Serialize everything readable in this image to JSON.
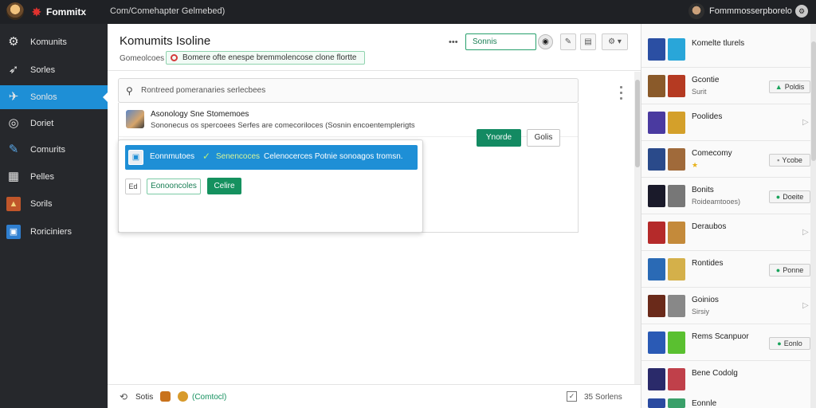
{
  "topbar": {
    "brand": "Fommitx",
    "crumb": "Com/Comehapter Gelmebed)",
    "user_name": "Fommmosserpborelo"
  },
  "sidebar": {
    "items": [
      {
        "label": "Komunits",
        "icon": "gear-icon"
      },
      {
        "label": "Sorles",
        "icon": "rocket-icon"
      },
      {
        "label": "Sonlos",
        "icon": "puzzle-icon"
      },
      {
        "label": "Doriet",
        "icon": "chat-icon"
      },
      {
        "label": "Comurits",
        "icon": "link-icon"
      },
      {
        "label": "Pelles",
        "icon": "grid-icon"
      },
      {
        "label": "Sorils",
        "icon": "image-icon"
      },
      {
        "label": "Roriciniers",
        "icon": "window-icon"
      }
    ],
    "active_index": 2,
    "accent": "#1e8fd6"
  },
  "main": {
    "title": "Komumits Isoline",
    "subtitle": "Gomeolcoes",
    "alert": "Bomere ofte enespe bremmolencose clone flortte",
    "more": "•••",
    "search_value": "Sonnis",
    "searchbar_placeholder": "Rontreed pomeranaries serlecbees",
    "row": {
      "name": "Asonology Sne Stomemoes",
      "desc": "Sononecus os spercoees Serfes are comecoriloces (Sosnin encoentemplerigts"
    },
    "primary_button": "Ynorde",
    "secondary_button": "Golis"
  },
  "popup": {
    "selected_a": "Eonnmutoes",
    "selected_b": "Senencoces",
    "selected_c": "Celenocerces Potnie sonoagos tromsn.",
    "small_label": "Ed",
    "ghost_button": "Eonooncoles",
    "ok_button": "Celire"
  },
  "bottombar": {
    "left_label": "Sotis",
    "status_label": "(Comtocl)",
    "right_label": "35 Sorlens"
  },
  "right_panel": {
    "items": [
      {
        "name": "Komelte tlurels",
        "sub": "",
        "action": "",
        "thumbs": [
          "#2b4fa3",
          "#29a6d9"
        ]
      },
      {
        "name": "Gcontie",
        "sub": "Surit",
        "action": "Poldis",
        "thumbs": [
          "#8a5a2a",
          "#b53a22"
        ]
      },
      {
        "name": "Poolides",
        "sub": "",
        "action": "",
        "thumbs": [
          "#4a3aa0",
          "#d4a02a"
        ]
      },
      {
        "name": "Comecomy",
        "sub": "★",
        "action": "Ycobe",
        "thumbs": [
          "#2a4a8a",
          "#a06a3a"
        ]
      },
      {
        "name": "Bonits",
        "sub": "Roideamtooes)",
        "action": "Doeite",
        "thumbs": [
          "#1a1a2a",
          "#777"
        ]
      },
      {
        "name": "Deraubos",
        "sub": "",
        "action": "",
        "thumbs": [
          "#b52a2a",
          "#c48a3a"
        ]
      },
      {
        "name": "Rontides",
        "sub": "",
        "action": "Ponne",
        "thumbs": [
          "#2a6ab5",
          "#d4b04a"
        ]
      },
      {
        "name": "Goinios",
        "sub": "Sirsiy",
        "action": "",
        "thumbs": [
          "#6a2a1a",
          "#888"
        ]
      },
      {
        "name": "Rems Scanpuor",
        "sub": "",
        "action": "Eonlo",
        "thumbs": [
          "#2a5ab5",
          "#5ac030"
        ]
      },
      {
        "name": "Bene Codolg",
        "sub": "",
        "action": "",
        "thumbs": [
          "#2a2a6a",
          "#c0404a"
        ]
      },
      {
        "name": "Eonnle",
        "sub": "",
        "action": "",
        "thumbs": [
          "#2a4aa0",
          "#3aa06a"
        ]
      }
    ]
  }
}
